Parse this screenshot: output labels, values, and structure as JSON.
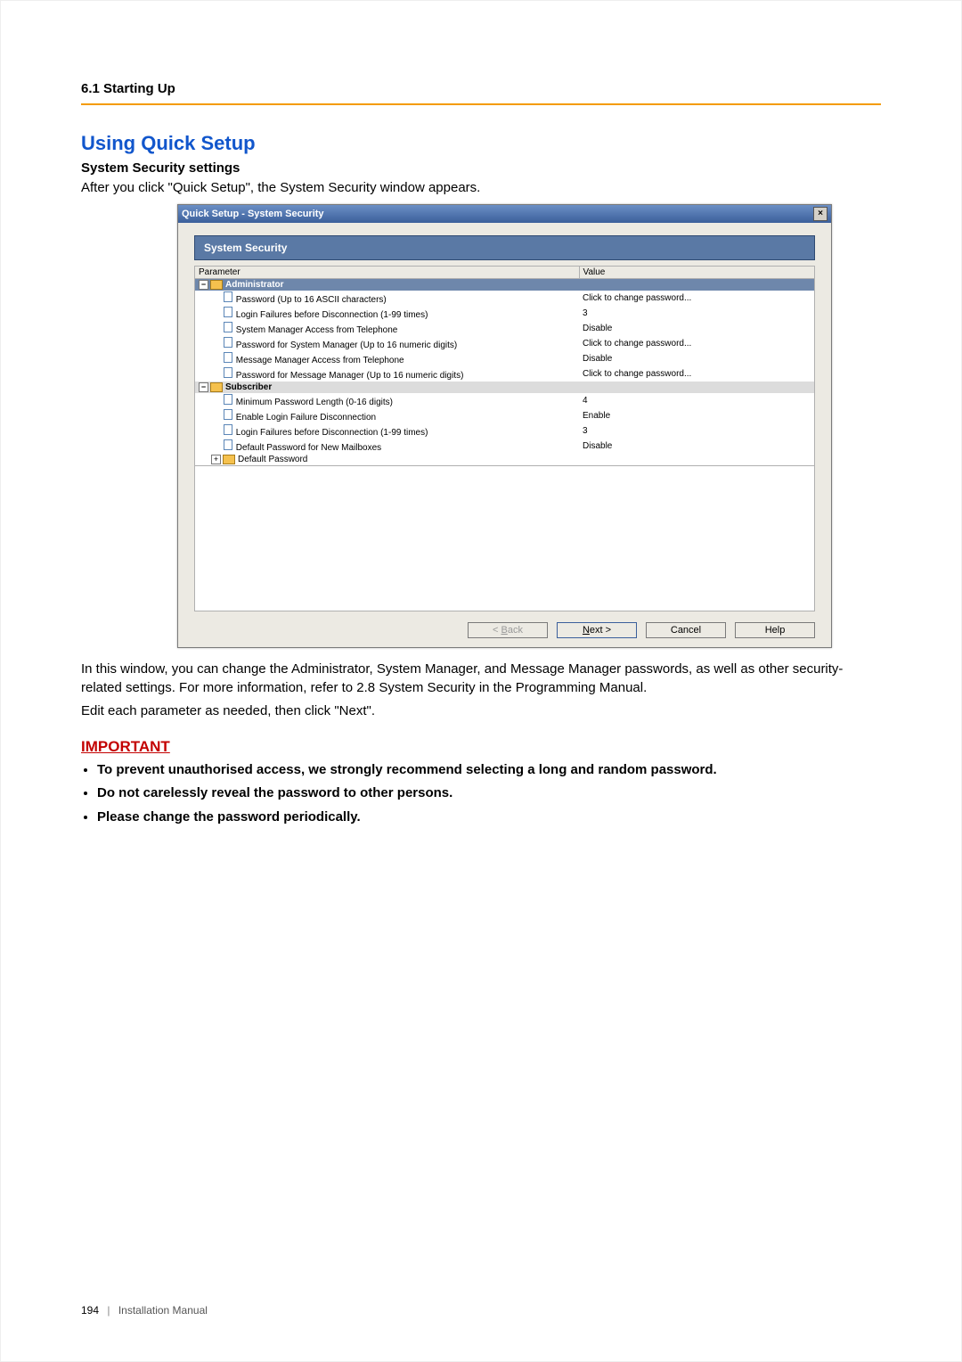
{
  "header": {
    "section": "6.1 Starting Up"
  },
  "title": "Using Quick Setup",
  "subhead": "System Security settings",
  "intro": "After you click \"Quick Setup\", the System Security window appears.",
  "dialog": {
    "title": "Quick Setup - System Security",
    "panel_title": "System Security",
    "columns": {
      "param": "Parameter",
      "value": "Value"
    },
    "groups": [
      {
        "label": "Administrator",
        "expanded": "−",
        "rows": [
          {
            "param": "Password (Up to 16 ASCII characters)",
            "value": "Click to change password..."
          },
          {
            "param": "Login Failures before Disconnection (1-99 times)",
            "value": "3"
          },
          {
            "param": "System Manager Access from Telephone",
            "value": "Disable"
          },
          {
            "param": "Password for System Manager (Up to 16 numeric digits)",
            "value": "Click to change password..."
          },
          {
            "param": "Message Manager Access from Telephone",
            "value": "Disable"
          },
          {
            "param": "Password for Message Manager (Up to 16 numeric digits)",
            "value": "Click to change password..."
          }
        ]
      },
      {
        "label": "Subscriber",
        "expanded": "−",
        "rows": [
          {
            "param": "Minimum Password Length (0-16 digits)",
            "value": "4"
          },
          {
            "param": "Enable Login Failure Disconnection",
            "value": "Enable"
          },
          {
            "param": "Login Failures before Disconnection (1-99 times)",
            "value": "3"
          },
          {
            "param": "Default Password for New Mailboxes",
            "value": "Disable"
          }
        ],
        "child_group": {
          "label": "Default Password",
          "expanded": "+"
        }
      }
    ],
    "buttons": {
      "back": "< Back",
      "next": "Next >",
      "cancel": "Cancel",
      "help": "Help"
    }
  },
  "after_dialog_p1": "In this window, you can change the Administrator, System Manager, and Message Manager passwords, as well as other security-related settings. For more information, refer to 2.8 System Security in the Programming Manual.",
  "after_dialog_p2": "Edit each parameter as needed, then click \"Next\".",
  "important": {
    "heading": "IMPORTANT",
    "items": [
      "To prevent unauthorised access, we strongly recommend selecting a long and random password.",
      "Do not carelessly reveal the password to other persons.",
      "Please change the password periodically."
    ]
  },
  "footer": {
    "page": "194",
    "label": "Installation Manual"
  }
}
